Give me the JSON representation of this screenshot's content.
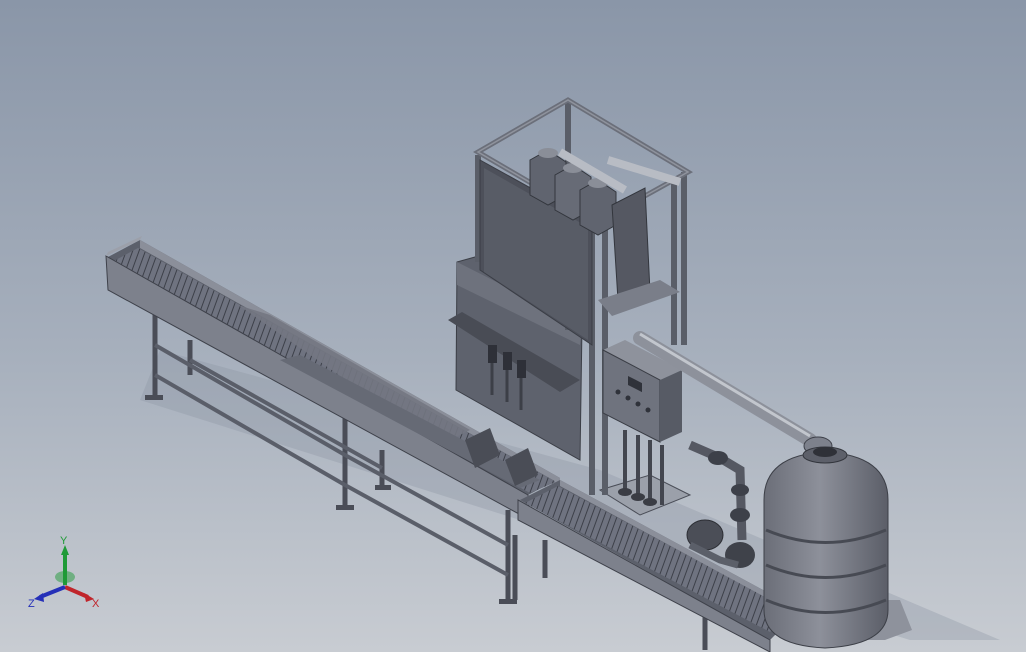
{
  "viewport": {
    "background_top": "#8a96a8",
    "background_mid": "#a7b0bd",
    "background_bottom": "#c8ccd2"
  },
  "triad": {
    "x_label": "X",
    "y_label": "Y",
    "z_label": "Z",
    "x_color": "#c0252b",
    "y_color": "#1f9a37",
    "z_color": "#2530b8"
  }
}
